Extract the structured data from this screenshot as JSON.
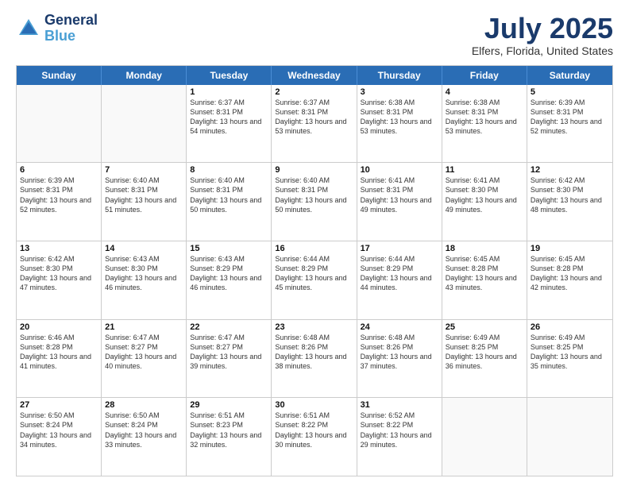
{
  "header": {
    "logo_line1": "General",
    "logo_line2": "Blue",
    "month_title": "July 2025",
    "location": "Elfers, Florida, United States"
  },
  "days_of_week": [
    "Sunday",
    "Monday",
    "Tuesday",
    "Wednesday",
    "Thursday",
    "Friday",
    "Saturday"
  ],
  "weeks": [
    [
      {
        "day": "",
        "sunrise": "",
        "sunset": "",
        "daylight": ""
      },
      {
        "day": "",
        "sunrise": "",
        "sunset": "",
        "daylight": ""
      },
      {
        "day": "1",
        "sunrise": "Sunrise: 6:37 AM",
        "sunset": "Sunset: 8:31 PM",
        "daylight": "Daylight: 13 hours and 54 minutes."
      },
      {
        "day": "2",
        "sunrise": "Sunrise: 6:37 AM",
        "sunset": "Sunset: 8:31 PM",
        "daylight": "Daylight: 13 hours and 53 minutes."
      },
      {
        "day": "3",
        "sunrise": "Sunrise: 6:38 AM",
        "sunset": "Sunset: 8:31 PM",
        "daylight": "Daylight: 13 hours and 53 minutes."
      },
      {
        "day": "4",
        "sunrise": "Sunrise: 6:38 AM",
        "sunset": "Sunset: 8:31 PM",
        "daylight": "Daylight: 13 hours and 53 minutes."
      },
      {
        "day": "5",
        "sunrise": "Sunrise: 6:39 AM",
        "sunset": "Sunset: 8:31 PM",
        "daylight": "Daylight: 13 hours and 52 minutes."
      }
    ],
    [
      {
        "day": "6",
        "sunrise": "Sunrise: 6:39 AM",
        "sunset": "Sunset: 8:31 PM",
        "daylight": "Daylight: 13 hours and 52 minutes."
      },
      {
        "day": "7",
        "sunrise": "Sunrise: 6:40 AM",
        "sunset": "Sunset: 8:31 PM",
        "daylight": "Daylight: 13 hours and 51 minutes."
      },
      {
        "day": "8",
        "sunrise": "Sunrise: 6:40 AM",
        "sunset": "Sunset: 8:31 PM",
        "daylight": "Daylight: 13 hours and 50 minutes."
      },
      {
        "day": "9",
        "sunrise": "Sunrise: 6:40 AM",
        "sunset": "Sunset: 8:31 PM",
        "daylight": "Daylight: 13 hours and 50 minutes."
      },
      {
        "day": "10",
        "sunrise": "Sunrise: 6:41 AM",
        "sunset": "Sunset: 8:31 PM",
        "daylight": "Daylight: 13 hours and 49 minutes."
      },
      {
        "day": "11",
        "sunrise": "Sunrise: 6:41 AM",
        "sunset": "Sunset: 8:30 PM",
        "daylight": "Daylight: 13 hours and 49 minutes."
      },
      {
        "day": "12",
        "sunrise": "Sunrise: 6:42 AM",
        "sunset": "Sunset: 8:30 PM",
        "daylight": "Daylight: 13 hours and 48 minutes."
      }
    ],
    [
      {
        "day": "13",
        "sunrise": "Sunrise: 6:42 AM",
        "sunset": "Sunset: 8:30 PM",
        "daylight": "Daylight: 13 hours and 47 minutes."
      },
      {
        "day": "14",
        "sunrise": "Sunrise: 6:43 AM",
        "sunset": "Sunset: 8:30 PM",
        "daylight": "Daylight: 13 hours and 46 minutes."
      },
      {
        "day": "15",
        "sunrise": "Sunrise: 6:43 AM",
        "sunset": "Sunset: 8:29 PM",
        "daylight": "Daylight: 13 hours and 46 minutes."
      },
      {
        "day": "16",
        "sunrise": "Sunrise: 6:44 AM",
        "sunset": "Sunset: 8:29 PM",
        "daylight": "Daylight: 13 hours and 45 minutes."
      },
      {
        "day": "17",
        "sunrise": "Sunrise: 6:44 AM",
        "sunset": "Sunset: 8:29 PM",
        "daylight": "Daylight: 13 hours and 44 minutes."
      },
      {
        "day": "18",
        "sunrise": "Sunrise: 6:45 AM",
        "sunset": "Sunset: 8:28 PM",
        "daylight": "Daylight: 13 hours and 43 minutes."
      },
      {
        "day": "19",
        "sunrise": "Sunrise: 6:45 AM",
        "sunset": "Sunset: 8:28 PM",
        "daylight": "Daylight: 13 hours and 42 minutes."
      }
    ],
    [
      {
        "day": "20",
        "sunrise": "Sunrise: 6:46 AM",
        "sunset": "Sunset: 8:28 PM",
        "daylight": "Daylight: 13 hours and 41 minutes."
      },
      {
        "day": "21",
        "sunrise": "Sunrise: 6:47 AM",
        "sunset": "Sunset: 8:27 PM",
        "daylight": "Daylight: 13 hours and 40 minutes."
      },
      {
        "day": "22",
        "sunrise": "Sunrise: 6:47 AM",
        "sunset": "Sunset: 8:27 PM",
        "daylight": "Daylight: 13 hours and 39 minutes."
      },
      {
        "day": "23",
        "sunrise": "Sunrise: 6:48 AM",
        "sunset": "Sunset: 8:26 PM",
        "daylight": "Daylight: 13 hours and 38 minutes."
      },
      {
        "day": "24",
        "sunrise": "Sunrise: 6:48 AM",
        "sunset": "Sunset: 8:26 PM",
        "daylight": "Daylight: 13 hours and 37 minutes."
      },
      {
        "day": "25",
        "sunrise": "Sunrise: 6:49 AM",
        "sunset": "Sunset: 8:25 PM",
        "daylight": "Daylight: 13 hours and 36 minutes."
      },
      {
        "day": "26",
        "sunrise": "Sunrise: 6:49 AM",
        "sunset": "Sunset: 8:25 PM",
        "daylight": "Daylight: 13 hours and 35 minutes."
      }
    ],
    [
      {
        "day": "27",
        "sunrise": "Sunrise: 6:50 AM",
        "sunset": "Sunset: 8:24 PM",
        "daylight": "Daylight: 13 hours and 34 minutes."
      },
      {
        "day": "28",
        "sunrise": "Sunrise: 6:50 AM",
        "sunset": "Sunset: 8:24 PM",
        "daylight": "Daylight: 13 hours and 33 minutes."
      },
      {
        "day": "29",
        "sunrise": "Sunrise: 6:51 AM",
        "sunset": "Sunset: 8:23 PM",
        "daylight": "Daylight: 13 hours and 32 minutes."
      },
      {
        "day": "30",
        "sunrise": "Sunrise: 6:51 AM",
        "sunset": "Sunset: 8:22 PM",
        "daylight": "Daylight: 13 hours and 30 minutes."
      },
      {
        "day": "31",
        "sunrise": "Sunrise: 6:52 AM",
        "sunset": "Sunset: 8:22 PM",
        "daylight": "Daylight: 13 hours and 29 minutes."
      },
      {
        "day": "",
        "sunrise": "",
        "sunset": "",
        "daylight": ""
      },
      {
        "day": "",
        "sunrise": "",
        "sunset": "",
        "daylight": ""
      }
    ]
  ]
}
